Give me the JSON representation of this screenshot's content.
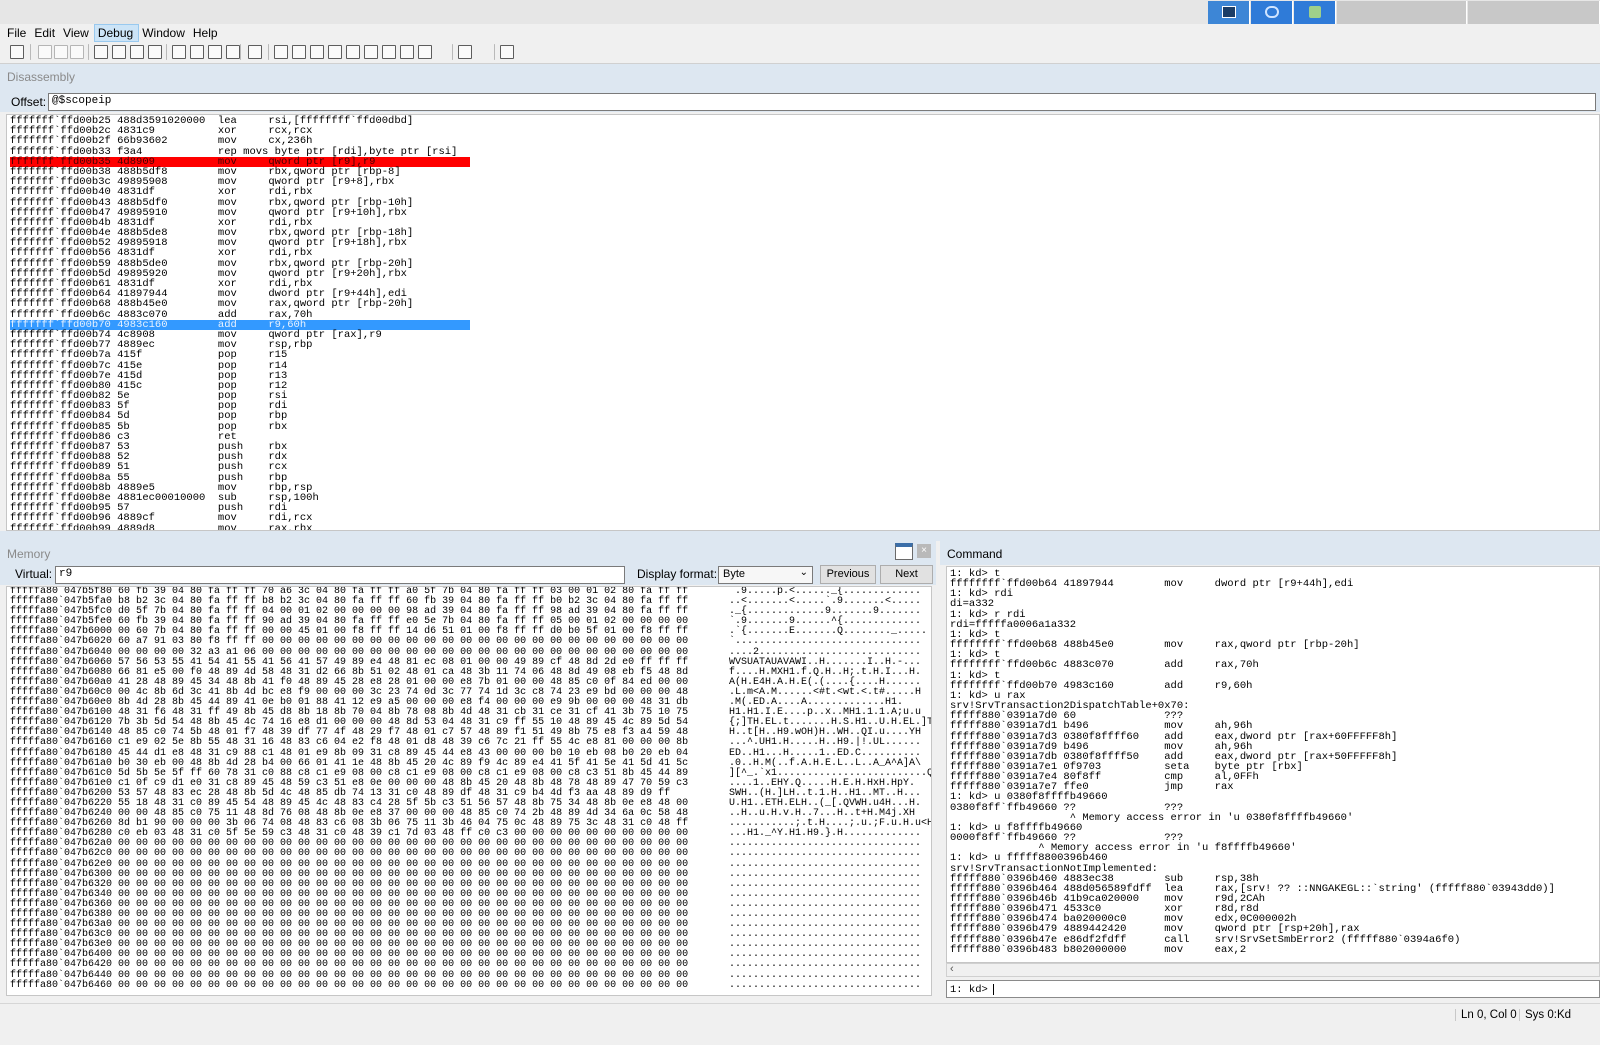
{
  "menubar": {
    "items": [
      "File",
      "Edit",
      "View",
      "Debug",
      "Window",
      "Help"
    ],
    "active": "Debug"
  },
  "toolbar": {
    "icons": [
      "open-icon",
      "cut-icon",
      "copy-icon",
      "paste-icon",
      "go-icon",
      "restart-icon",
      "stop-icon",
      "break-icon",
      "step-into-icon",
      "step-over-icon",
      "step-out-icon",
      "run-to-cursor-icon",
      "command-window-icon",
      "watch-window-icon",
      "locals-window-icon",
      "registers-window-icon",
      "memory-window-icon",
      "call-stack-icon",
      "disassembly-window-icon",
      "scratch-pad-icon",
      "source-mode-icon",
      "hex-mode-icon",
      "font-icon",
      "options-icon"
    ]
  },
  "disassembly": {
    "title": "Disassembly",
    "offset_label": "Offset:",
    "offset_value": "@$scopeip",
    "lines": [
      "fffffff`ffd00b25 488d3591020000  lea     rsi,[ffffffff`ffd00dbd]",
      "fffffff`ffd00b2c 4831c9          xor     rcx,rcx",
      "fffffff`ffd00b2f 66b93602        mov     cx,236h",
      "fffffff`ffd00b33 f3a4            rep movs byte ptr [rdi],byte ptr [rsi]",
      "fffffff`ffd00b35 4d8909          mov     qword ptr [r9],r9",
      "fffffff`ffd00b38 488b5df8        mov     rbx,qword ptr [rbp-8]",
      "fffffff`ffd00b3c 49895908        mov     qword ptr [r9+8],rbx",
      "fffffff`ffd00b40 4831df          xor     rdi,rbx",
      "fffffff`ffd00b43 488b5df0        mov     rbx,qword ptr [rbp-10h]",
      "fffffff`ffd00b47 49895910        mov     qword ptr [r9+10h],rbx",
      "fffffff`ffd00b4b 4831df          xor     rdi,rbx",
      "fffffff`ffd00b4e 488b5de8        mov     rbx,qword ptr [rbp-18h]",
      "fffffff`ffd00b52 49895918        mov     qword ptr [r9+18h],rbx",
      "fffffff`ffd00b56 4831df          xor     rdi,rbx",
      "fffffff`ffd00b59 488b5de0        mov     rbx,qword ptr [rbp-20h]",
      "fffffff`ffd00b5d 49895920        mov     qword ptr [r9+20h],rbx",
      "fffffff`ffd00b61 4831df          xor     rdi,rbx",
      "fffffff`ffd00b64 41897944        mov     dword ptr [r9+44h],edi",
      "fffffff`ffd00b68 488b45e0        mov     rax,qword ptr [rbp-20h]",
      "fffffff`ffd00b6c 4883c070        add     rax,70h",
      "fffffff`ffd00b70 4983c160        add     r9,60h",
      "fffffff`ffd00b74 4c8908          mov     qword ptr [rax],r9",
      "fffffff`ffd00b77 4889ec          mov     rsp,rbp",
      "fffffff`ffd00b7a 415f            pop     r15",
      "fffffff`ffd00b7c 415e            pop     r14",
      "fffffff`ffd00b7e 415d            pop     r13",
      "fffffff`ffd00b80 415c            pop     r12",
      "fffffff`ffd00b82 5e              pop     rsi",
      "fffffff`ffd00b83 5f              pop     rdi",
      "fffffff`ffd00b84 5d              pop     rbp",
      "fffffff`ffd00b85 5b              pop     rbx",
      "fffffff`ffd00b86 c3              ret",
      "fffffff`ffd00b87 53              push    rbx",
      "fffffff`ffd00b88 52              push    rdx",
      "fffffff`ffd00b89 51              push    rcx",
      "fffffff`ffd00b8a 55              push    rbp",
      "fffffff`ffd00b8b 4889e5          mov     rbp,rsp",
      "fffffff`ffd00b8e 4881ec00010000  sub     rsp,100h",
      "fffffff`ffd00b95 57              push    rdi",
      "fffffff`ffd00b96 4889cf          mov     rdi,rcx",
      "fffffff`ffd00b99 4889d8          mov     rax,rbx"
    ],
    "breakpoint_line": 4,
    "current_line": 20,
    "breakpoint_color": "#ff0000",
    "current_color": "#3399ff"
  },
  "memory": {
    "title": "Memory",
    "virtual_label": "Virtual:",
    "virtual_value": "r9",
    "format_label": "Display format:",
    "format_value": "Byte",
    "prev_label": "Previous",
    "next_label": "Next",
    "lines": [
      "fffffa80`047b5f80 60 fb 39 04 80 fa ff ff 70 a6 3c 04 80 fa ff ff a0 5f 7b 04 80 fa ff ff 03 00 01 02 80 fa ff ff",
      "fffffa80`047b5fa0 b8 b2 3c 04 80 fa ff ff b8 b2 3c 04 80 fa ff ff 60 fb 39 04 80 fa ff ff b0 b2 3c 04 80 fa ff ff",
      "fffffa80`047b5fc0 d0 5f 7b 04 80 fa ff ff 04 00 01 02 00 00 00 00 98 ad 39 04 80 fa ff ff 98 ad 39 04 80 fa ff ff",
      "fffffa80`047b5fe0 60 fb 39 04 80 fa ff ff 90 ad 39 04 80 fa ff ff e0 5e 7b 04 80 fa ff ff 05 00 01 02 00 00 00 00",
      "fffffa80`047b6000 00 60 7b 04 80 fa ff ff 00 00 45 01 00 f8 ff ff 14 d6 51 01 00 f8 ff ff d0 b0 5f 01 00 f8 ff ff",
      "fffffa80`047b6020 60 a7 91 03 80 f8 ff ff 00 00 00 00 00 00 00 00 00 00 00 00 00 00 00 00 00 00 00 00 00 00 00 00",
      "fffffa80`047b6040 00 00 00 00 32 a3 a1 06 00 00 00 00 00 00 00 00 00 00 00 00 00 00 00 00 00 00 00 00 00 00 00 00",
      "fffffa80`047b6060 57 56 53 55 41 54 41 55 41 56 41 57 49 89 e4 48 81 ec 08 01 00 00 49 89 cf 48 8d 2d e0 ff ff ff",
      "fffffa80`047b6080 66 81 e5 00 f0 48 89 4d 58 48 31 d2 66 8b 51 02 48 01 ca 48 3b 11 74 06 48 8d 49 08 eb f5 48 8d",
      "fffffa80`047b60a0 41 28 48 89 45 34 48 8b 41 f0 48 89 45 28 e8 28 01 00 00 e8 7b 01 00 00 48 85 c0 0f 84 ed 00 00",
      "fffffa80`047b60c0 00 4c 8b 6d 3c 41 8b 4d bc e8 f9 00 00 00 3c 23 74 0d 3c 77 74 1d 3c c8 74 23 e9 bd 00 00 00 48",
      "fffffa80`047b60e0 8b 4d 28 8b 45 44 89 41 0e b0 01 88 41 12 e9 a5 00 00 00 e8 f4 00 00 00 e9 9b 00 00 00 48 31 db",
      "fffffa80`047b6100 48 31 f6 48 31 ff 49 8b 45 d8 8b 18 8b 70 04 8b 78 08 8b 4d 48 31 cb 31 ce 31 cf 41 3b 75 10 75",
      "fffffa80`047b6120 7b 3b 5d 54 48 8b 45 4c 74 16 e8 d1 00 00 00 48 8d 53 04 48 31 c9 ff 55 10 48 89 45 4c 89 5d 54",
      "fffffa80`047b6140 48 85 c0 74 5b 48 01 f7 48 39 df 77 4f 48 29 f7 48 01 c7 57 48 89 f1 51 49 8b 75 e8 f3 a4 59 48",
      "fffffa80`047b6160 c1 e9 02 5e 8b 55 48 31 16 48 83 c6 04 e2 f8 48 01 d8 48 39 c6 7c 21 ff 55 4c e8 81 00 00 00 8b",
      "fffffa80`047b6180 45 44 d1 e8 48 31 c9 88 c1 48 01 e9 8b 09 31 c8 89 45 44 e8 43 00 00 00 b0 10 eb 08 b0 20 eb 04",
      "fffffa80`047b61a0 b0 30 eb 00 48 8b 4d 28 b4 00 66 01 41 1e 48 8b 45 20 4c 89 f9 4c 89 e4 41 5f 41 5e 41 5d 41 5c",
      "fffffa80`047b61c0 5d 5b 5e 5f ff 60 78 31 c0 88 c8 c1 e9 08 00 c8 c1 e9 08 00 c8 c1 e9 08 00 c8 c3 51 8b 45 44 89",
      "fffffa80`047b61e0 c1 0f c9 d1 e0 31 c8 89 45 48 59 c3 51 e8 0e 00 00 00 48 8b 45 20 48 8b 48 78 48 89 47 70 59 c3",
      "fffffa80`047b6200 53 57 48 83 ec 28 48 8b 5d 4c 48 85 db 74 13 31 c0 48 89 df 48 31 c9 b4 4d f3 aa 48 89 d9 ff",
      "fffffa80`047b6220 55 18 48 31 c0 89 45 54 48 89 45 4c 48 83 c4 28 5f 5b c3 51 56 57 48 8b 75 34 48 8b 0e e8 48 00",
      "fffffa80`047b6240 00 00 48 85 c0 75 11 48 8d 76 08 48 8b 0e e8 37 00 00 00 48 85 c0 74 2b 48 89 4d 34 6a 0c 58 48",
      "fffffa80`047b6260 8d b1 90 00 00 00 3b 06 74 08 48 83 c6 08 3b 06 75 11 3b 46 04 75 0c 48 89 75 3c 48 31 c0 48 ff",
      "fffffa80`047b6280 c0 eb 03 48 31 c0 5f 5e 59 c3 48 31 c0 48 39 c1 7d 03 48 ff c0 c3 00 00 00 00 00 00 00 00 00 00",
      "fffffa80`047b62a0 00 00 00 00 00 00 00 00 00 00 00 00 00 00 00 00 00 00 00 00 00 00 00 00 00 00 00 00 00 00 00 00",
      "fffffa80`047b62c0 00 00 00 00 00 00 00 00 00 00 00 00 00 00 00 00 00 00 00 00 00 00 00 00 00 00 00 00 00 00 00 00",
      "fffffa80`047b62e0 00 00 00 00 00 00 00 00 00 00 00 00 00 00 00 00 00 00 00 00 00 00 00 00 00 00 00 00 00 00 00 00",
      "fffffa80`047b6300 00 00 00 00 00 00 00 00 00 00 00 00 00 00 00 00 00 00 00 00 00 00 00 00 00 00 00 00 00 00 00 00",
      "fffffa80`047b6320 00 00 00 00 00 00 00 00 00 00 00 00 00 00 00 00 00 00 00 00 00 00 00 00 00 00 00 00 00 00 00 00",
      "fffffa80`047b6340 00 00 00 00 00 00 00 00 00 00 00 00 00 00 00 00 00 00 00 00 00 00 00 00 00 00 00 00 00 00 00 00",
      "fffffa80`047b6360 00 00 00 00 00 00 00 00 00 00 00 00 00 00 00 00 00 00 00 00 00 00 00 00 00 00 00 00 00 00 00 00",
      "fffffa80`047b6380 00 00 00 00 00 00 00 00 00 00 00 00 00 00 00 00 00 00 00 00 00 00 00 00 00 00 00 00 00 00 00 00",
      "fffffa80`047b63a0 00 00 00 00 00 00 00 00 00 00 00 00 00 00 00 00 00 00 00 00 00 00 00 00 00 00 00 00 00 00 00 00",
      "fffffa80`047b63c0 00 00 00 00 00 00 00 00 00 00 00 00 00 00 00 00 00 00 00 00 00 00 00 00 00 00 00 00 00 00 00 00",
      "fffffa80`047b63e0 00 00 00 00 00 00 00 00 00 00 00 00 00 00 00 00 00 00 00 00 00 00 00 00 00 00 00 00 00 00 00 00",
      "fffffa80`047b6400 00 00 00 00 00 00 00 00 00 00 00 00 00 00 00 00 00 00 00 00 00 00 00 00 00 00 00 00 00 00 00 00",
      "fffffa80`047b6420 00 00 00 00 00 00 00 00 00 00 00 00 00 00 00 00 00 00 00 00 00 00 00 00 00 00 00 00 00 00 00 00",
      "fffffa80`047b6440 00 00 00 00 00 00 00 00 00 00 00 00 00 00 00 00 00 00 00 00 00 00 00 00 00 00 00 00 00 00 00 00",
      "fffffa80`047b6460 00 00 00 00 00 00 00 00 00 00 00 00 00 00 00 00 00 00 00 00 00 00 00 00 00 00 00 00 00 00 00 00"
    ],
    "ascii": [
      "`.9.....p.<......_{.............",
      "..<.......<.....`.9.......<.....",
      "._{.............9.......9.......",
      "`.9.......9......^{.............",
      ".`{.......E.......Q........_.....",
      "`...............................",
      "....2...........................",
      "WVSUATAUAVAWI..H.......I..H.-...",
      "f....H.MXH1.f.Q.H..H;.t.H.I...H.",
      "A(H.E4H.A.H.E(.(....{....H......",
      ".L.m<A.M......<#t.<wt.<.t#.....H",
      ".M(.ED.A....A.............H1.",
      "H1.H1.I.E....p..x..MH1.1.1.A;u.u",
      "{;]TH.EL.t.......H.S.H1..U.H.EL.]T",
      "H..t[H..H9.wOH)H..WH..QI.u....YH",
      "...^.UH1.H.....H..H9.|!.UL......",
      "ED..H1...H.....1..ED.C..........",
      ".0..H.M(..f.A.H.E.L..L..A_A^A]A\\",
      "][^_.`x1.........................Q.ED.",
      "....1..EHY.Q.....H.E.H.HxH.HpY.",
      "SWH..(H.]LH..t.1.H..H1..MT..H...",
      "U.H1..ETH.ELH..(_[.QVWH.u4H...H.",
      "..H..u.H.v.H..7...H..t+H.M4j.XH",
      "...........;.t.H....;.u.;F.u.H.u<H1.H.",
      "...H1._^Y.H1.H9.}.H.............",
      "................................",
      "................................",
      "................................",
      "................................",
      "................................",
      "................................",
      "................................",
      "................................",
      "................................",
      "................................",
      "................................",
      "................................",
      "................................",
      "................................",
      "................................"
    ]
  },
  "command": {
    "title": "Command",
    "lines": [
      "1: kd> t",
      "ffffffff`ffd00b64 41897944        mov     dword ptr [r9+44h],edi",
      "1: kd> rdi",
      "di=a332",
      "1: kd> r rdi",
      "rdi=fffffa0006a1a332",
      "1: kd> t",
      "ffffffff`ffd00b68 488b45e0        mov     rax,qword ptr [rbp-20h]",
      "1: kd> t",
      "ffffffff`ffd00b6c 4883c070        add     rax,70h",
      "1: kd> t",
      "ffffffff`ffd00b70 4983c160        add     r9,60h",
      "1: kd> u rax",
      "srv!SrvTransaction2DispatchTable+0x70:",
      "fffff880`0391a7d0 60              ???",
      "fffff880`0391a7d1 b496            mov     ah,96h",
      "fffff880`0391a7d3 0380f8ffff60    add     eax,dword ptr [rax+60FFFFF8h]",
      "fffff880`0391a7d9 b496            mov     ah,96h",
      "fffff880`0391a7db 0380f8ffff50    add     eax,dword ptr [rax+50FFFFF8h]",
      "fffff880`0391a7e1 0f9703          seta    byte ptr [rbx]",
      "fffff880`0391a7e4 80f8ff          cmp     al,0FFh",
      "fffff880`0391a7e7 ffe0            jmp     rax",
      "1: kd> u 0380f8ffffb49660",
      "0380f8ff`ffb49660 ??              ???",
      "                   ^ Memory access error in 'u 0380f8ffffb49660'",
      "1: kd> u f8ffffb49660",
      "0000f8ff`ffb49660 ??              ???",
      "              ^ Memory access error in 'u f8ffffb49660'",
      "1: kd> u fffff8800396b460",
      "srv!SrvTransactionNotImplemented:",
      "fffff880`0396b460 4883ec38        sub     rsp,38h",
      "fffff880`0396b464 488d056589fdff  lea     rax,[srv! ?? ::NNGAKEGL::`string' (fffff880`03943dd0)]",
      "fffff880`0396b46b 41b9ca020000    mov     r9d,2CAh",
      "fffff880`0396b471 4533c0          xor     r8d,r8d",
      "fffff880`0396b474 ba020000c0      mov     edx,0C000002h",
      "fffff880`0396b479 4889442420      mov     qword ptr [rsp+20h],rax",
      "fffff880`0396b47e e86df2fdff      call    srv!SrvSetSmbError2 (fffff880`0394a6f0)",
      "fffff880`0396b483 b802000000      mov     eax,2"
    ],
    "prompt": "1: kd>"
  },
  "status": {
    "position": "Ln 0, Col 0",
    "sys": "Sys 0:Kd"
  },
  "colors": {
    "panel_header_bg": "#dde7f1",
    "tray_accent": "#2f7bd8"
  }
}
